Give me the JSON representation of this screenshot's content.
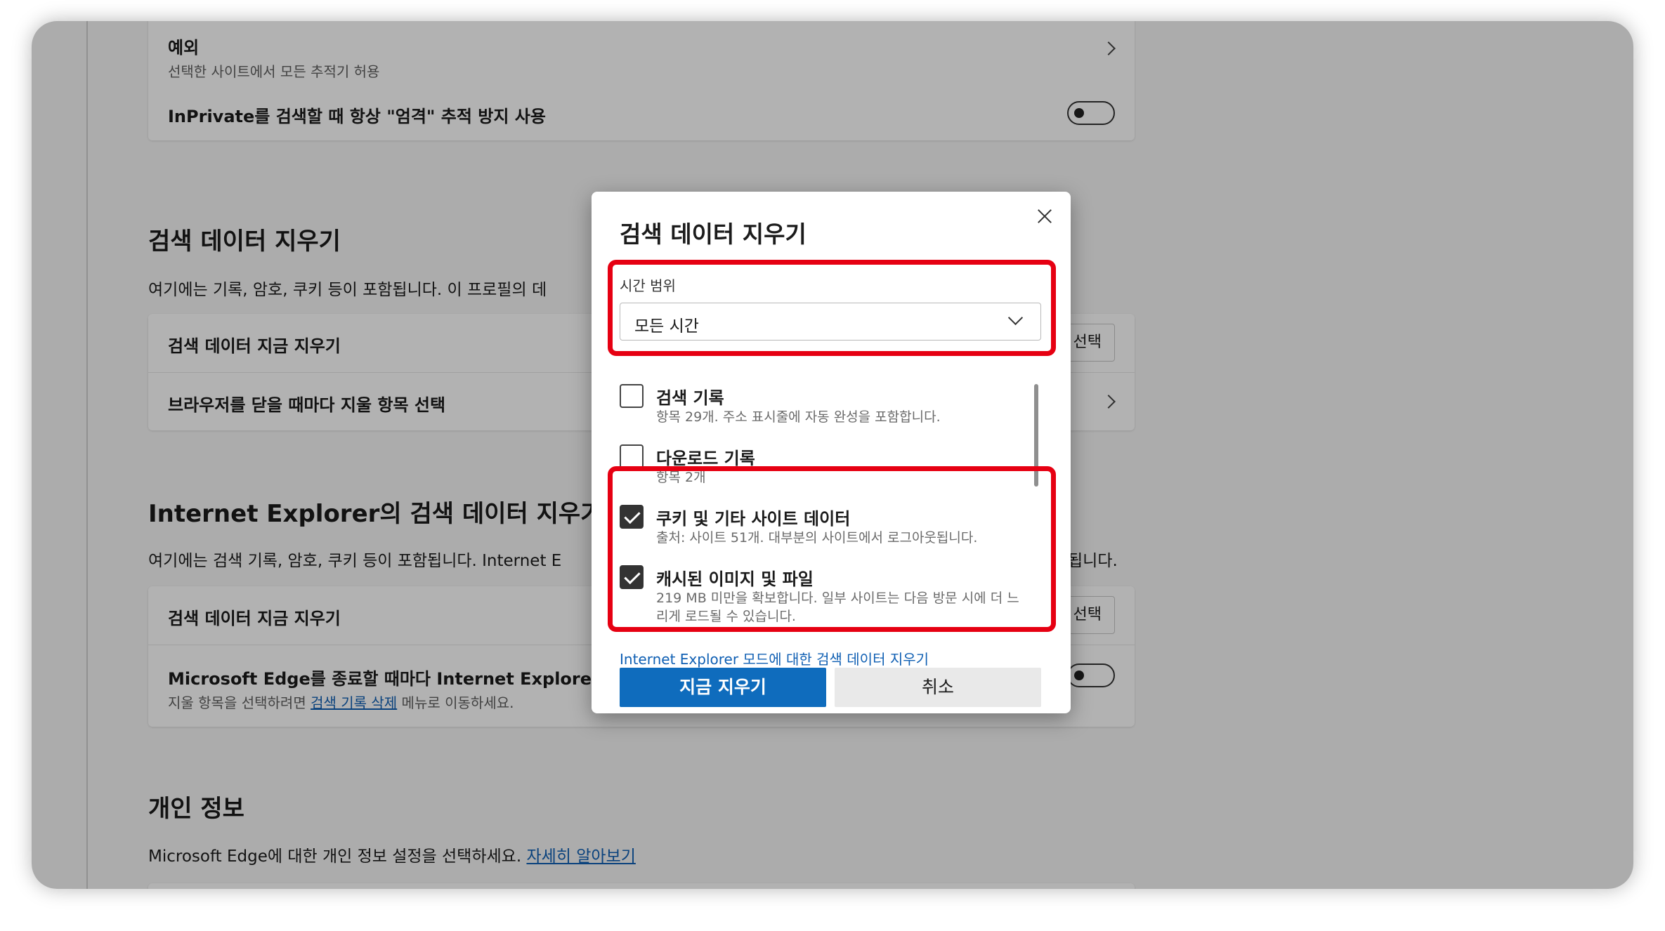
{
  "background": {
    "tracking_card": {
      "exceptions_title": "예외",
      "exceptions_sub": "선택한 사이트에서 모든 추적기 허용",
      "inprivate_label": "InPrivate를 검색할 때 항상 \"엄격\" 추적 방지 사용"
    },
    "clear_section": {
      "title": "검색 데이터 지우기",
      "desc": "여기에는 기록, 암호, 쿠키 등이 포함됩니다. 이 프로필의 데",
      "clear_now": "검색 데이터 지금 지우기",
      "choose_button": "선택",
      "on_close": "브라우저를 닫을 때마다 지울 항목 선택"
    },
    "ie_section": {
      "title": "Internet Explorer의 검색 데이터 지우기",
      "desc_start": "여기에는 검색 기록, 암호, 쿠키 등이 포함됩니다. Internet E",
      "desc_end": "됩니다.",
      "clear_now": "검색 데이터 지금 지우기",
      "choose_button": "선택",
      "on_exit": "Microsoft Edge를 종료할 때마다 Internet Explorer 및 I",
      "on_exit_sub_prefix": "지울 항목을 선택하려면 ",
      "on_exit_sub_link": "검색 기록 삭제",
      "on_exit_sub_suffix": " 메뉴로 이동하세요."
    },
    "privacy_section": {
      "title": "개인 정보",
      "desc": "Microsoft Edge에 대한 개인 정보 설정을 선택하세요. ",
      "learn_more": "자세히 알아보기"
    }
  },
  "dialog": {
    "title": "검색 데이터 지우기",
    "time_range_label": "시간 범위",
    "time_range_value": "모든 시간",
    "options": [
      {
        "title": "검색 기록",
        "sub": "항목 29개. 주소 표시줄에 자동 완성을 포함합니다.",
        "checked": false
      },
      {
        "title": "다운로드 기록",
        "sub": "항목 2개",
        "checked": false
      },
      {
        "title": "쿠키 및 기타 사이트 데이터",
        "sub": "출처: 사이트 51개. 대부분의 사이트에서 로그아웃됩니다.",
        "checked": true
      },
      {
        "title": "캐시된 이미지 및 파일",
        "sub": "219 MB 미만을 확보합니다. 일부 사이트는 다음 방문 시에 더 느리게 로드될 수 있습니다.",
        "checked": true
      }
    ],
    "ie_link": "Internet Explorer 모드에 대한 검색 데이터 지우기",
    "clear_now_button": "지금 지우기",
    "cancel_button": "취소"
  },
  "colors": {
    "highlight": "#e60012",
    "primary": "#0f6cbd",
    "link": "#0f5fb3"
  }
}
